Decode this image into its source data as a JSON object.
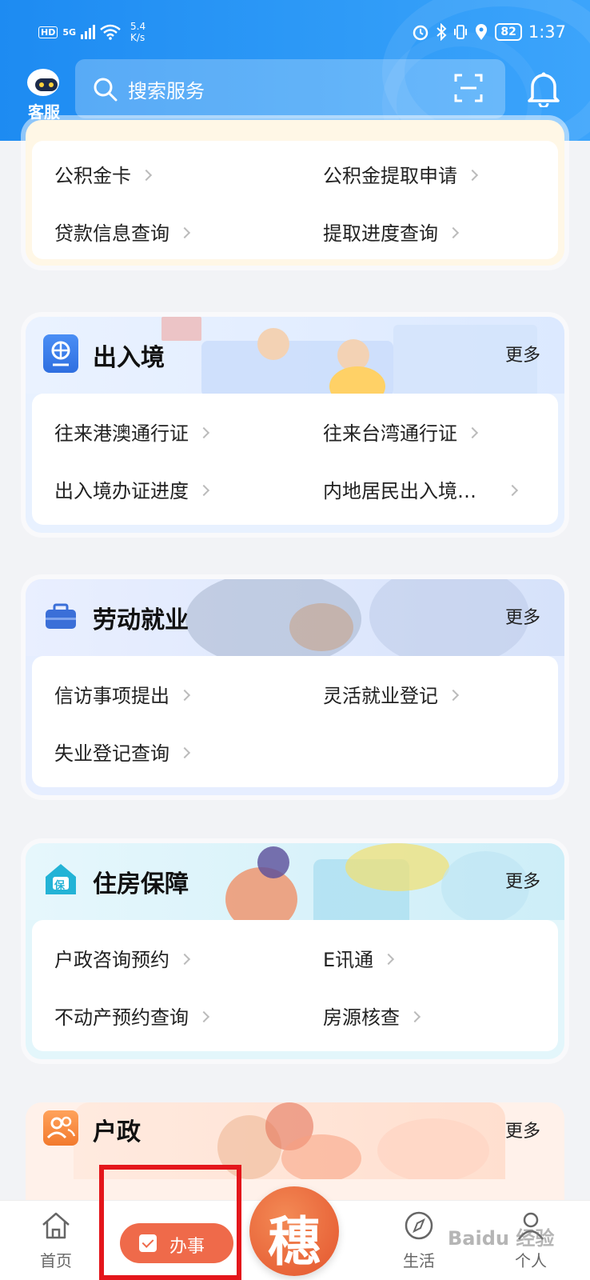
{
  "status_bar": {
    "hd": "HD",
    "signal": "5G",
    "speed_value": "5.4",
    "speed_unit": "K/s",
    "battery": "82",
    "time": "1:37"
  },
  "header": {
    "service_label": "客服",
    "search_placeholder": "搜索服务"
  },
  "cards": {
    "fund": {
      "items": [
        "公积金卡",
        "公积金提取申请",
        "贷款信息查询",
        "提取进度查询"
      ]
    },
    "immigration": {
      "title": "出入境",
      "more": "更多",
      "items": [
        "往来港澳通行证",
        "往来台湾通行证",
        "出入境办证进度",
        "内地居民出入境…"
      ]
    },
    "labor": {
      "title": "劳动就业",
      "more": "更多",
      "items": [
        "信访事项提出",
        "灵活就业登记",
        "失业登记查询"
      ]
    },
    "housing": {
      "title": "住房保障",
      "more": "更多",
      "icon_text": "保",
      "items": [
        "户政咨询预约",
        "E讯通",
        "不动产预约查询",
        "房源核查"
      ]
    },
    "household": {
      "title": "户政",
      "more": "更多"
    }
  },
  "bottom_nav": {
    "home": "首页",
    "services": "办事",
    "center_glyph": "穗",
    "life": "生活",
    "personal": "个人"
  },
  "watermark": "Baidu 经验",
  "colors": {
    "header_blue": "#1d8bf2",
    "accent_orange": "#ef6a4a",
    "highlight_red": "#e4161b"
  }
}
